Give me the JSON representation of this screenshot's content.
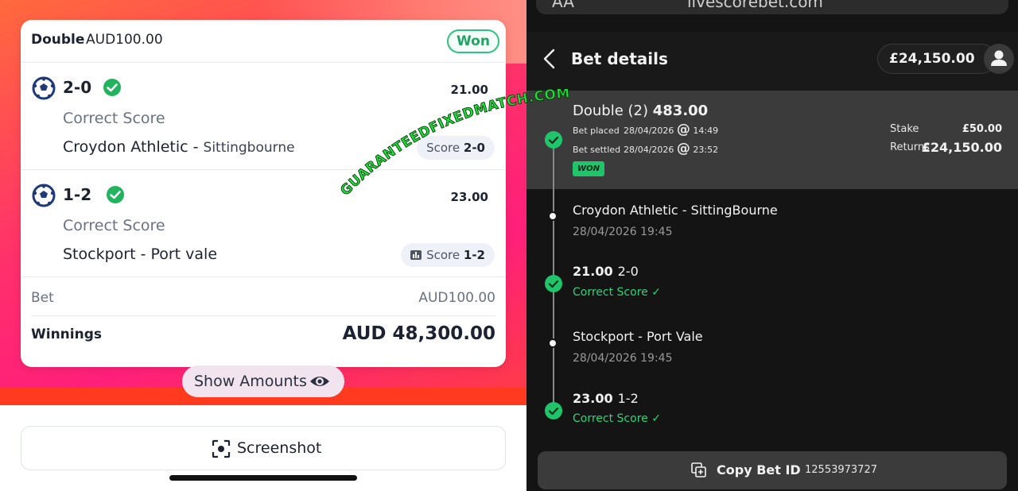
{
  "left": {
    "card": {
      "bet_type": "Double",
      "stake_header": "AUD100.00",
      "status": "Won",
      "selections": [
        {
          "score": "2-0",
          "odds": "21.00",
          "market": "Correct Score",
          "home": "Croydon Athletic - ",
          "away": "Sittingbourne",
          "result_label": "Score",
          "result_value": "2-0"
        },
        {
          "score": "1-2",
          "odds": "23.00",
          "market": "Correct Score",
          "home": "Stockport - Port vale",
          "away": "",
          "result_label": "Score",
          "result_value": "1-2"
        }
      ],
      "bet_label": "Bet",
      "bet_value": "AUD100.00",
      "winnings_label": "Winnings",
      "winnings_value": "AUD 48,300.00"
    },
    "show_amounts_label": "Show Amounts",
    "screenshot_label": "Screenshot"
  },
  "watermark": "GUARANTEEDFIXEDMATCH.COM",
  "right": {
    "url_text": "livescorebet.com",
    "url_prefix": "AA",
    "title": "Bet details",
    "balance": "£24,150.00",
    "summary": {
      "bet_type": "Double (2)",
      "total_odds": "483.00",
      "placed_label": "Bet placed",
      "placed_date": "28/04/2026",
      "placed_time": "14:49",
      "settled_label": "Bet settled",
      "settled_date": "28/04/2026",
      "settled_time": "23:52",
      "at": "@",
      "status": "WON",
      "stake_label": "Stake",
      "stake_value": "£50.00",
      "returns_label": "Returns",
      "returns_value": "£24,150.00"
    },
    "legs": [
      {
        "event": "Croydon Athletic - SittingBourne",
        "datetime": "28/04/2026 19:45",
        "odds": "21.00",
        "score": "2-0",
        "market": "Correct Score ✓"
      },
      {
        "event": "Stockport - Port Vale",
        "datetime": "28/04/2026 19:45",
        "odds": "23.00",
        "score": "1-2",
        "market": "Correct Score ✓"
      }
    ],
    "copy_label": "Copy Bet ID",
    "bet_id": "12553973727"
  }
}
